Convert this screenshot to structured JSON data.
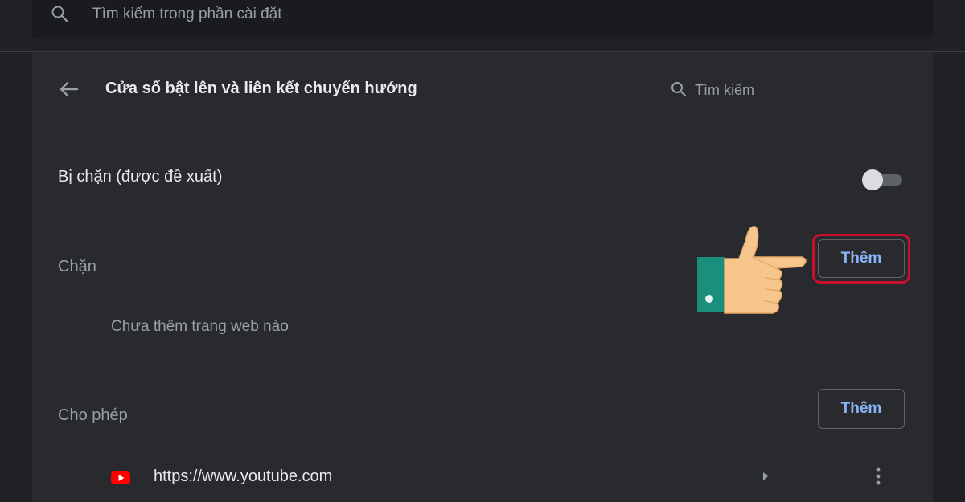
{
  "global_search": {
    "placeholder": "Tìm kiếm trong phần cài đặt",
    "icon": "search-icon"
  },
  "header": {
    "title": "Cửa sổ bật lên và liên kết chuyển hướng",
    "back_icon": "arrow-back-icon",
    "search_placeholder": "Tìm kiếm"
  },
  "blocked_setting": {
    "label": "Bị chặn (được đề xuất)",
    "toggle_on": false
  },
  "block_section": {
    "title": "Chặn",
    "add_label": "Thêm",
    "empty_text": "Chưa thêm trang web nào"
  },
  "allow_section": {
    "title": "Cho phép",
    "add_label": "Thêm",
    "sites": [
      {
        "url": "https://www.youtube.com",
        "icon": "youtube-icon"
      }
    ]
  },
  "colors": {
    "background": "#202124",
    "card": "#292a2d",
    "accent": "#8ab4f8",
    "highlight": "#c8102e"
  }
}
